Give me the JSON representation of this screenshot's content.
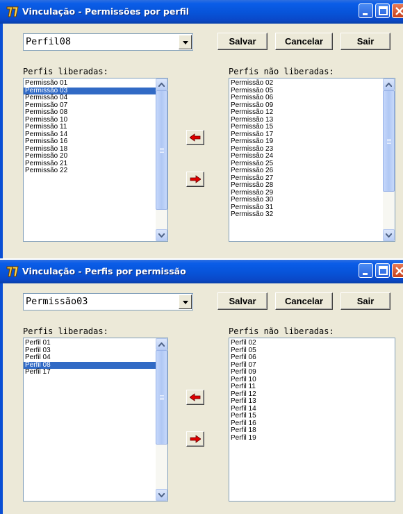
{
  "windows": [
    {
      "title": "Vinculação - Permissões por perfil",
      "combo_value": "Perfil08",
      "buttons": {
        "save": "Salvar",
        "cancel": "Cancelar",
        "exit": "Sair"
      },
      "left_label": "Perfis liberadas:",
      "right_label": "Perfis não liberadas:",
      "left_items": [
        "Permissão 01",
        "Permissão 03",
        "Permissão 04",
        "Permissão 07",
        "Permissão 08",
        "Permissão 10",
        "Permissão 11",
        "Permissão 14",
        "Permissão 16",
        "Permissão 18",
        "Permissão 20",
        "Permissão 21",
        "Permissão 22"
      ],
      "left_selected": "Permissão 03",
      "right_items": [
        "Permissão 02",
        "Permissão 05",
        "Permissão 06",
        "Permissão 09",
        "Permissão 12",
        "Permissão 13",
        "Permissão 15",
        "Permissão 17",
        "Permissão 19",
        "Permissão 23",
        "Permissão 24",
        "Permissão 25",
        "Permissão 26",
        "Permissão 27",
        "Permissão 28",
        "Permissão 29",
        "Permissão 30",
        "Permissão 31",
        "Permissão 32"
      ]
    },
    {
      "title": "Vinculação - Perfis por permissão",
      "combo_value": "Permissão03",
      "buttons": {
        "save": "Salvar",
        "cancel": "Cancelar",
        "exit": "Sair"
      },
      "left_label": "Perfis liberadas:",
      "right_label": "Perfis não liberadas:",
      "left_items": [
        "Perfil 01",
        "Perfil 03",
        "Perfil 04",
        "Perfil 08",
        "Perfil 17"
      ],
      "left_selected": "Perfil 08",
      "right_items": [
        "Perfil 02",
        "Perfil 05",
        "Perfil 06",
        "Perfil 07",
        "Perfil 09",
        "Perfil 10",
        "Perfil 11",
        "Perfil 12",
        "Perfil 13",
        "Perfil 14",
        "Perfil 15",
        "Perfil 16",
        "Perfil 18",
        "Perfil 19"
      ]
    }
  ],
  "icons": {
    "title_icon": "app-icon",
    "minimize": "minimize-icon",
    "maximize": "maximize-icon",
    "close": "close-icon",
    "move_left": "arrow-left-icon",
    "move_right": "arrow-right-icon",
    "dropdown": "chevron-down-icon"
  },
  "colors": {
    "titlebar": "#0a5de8",
    "selection": "#316ac5",
    "arrow": "#e00000",
    "window_bg": "#ece9d8"
  }
}
